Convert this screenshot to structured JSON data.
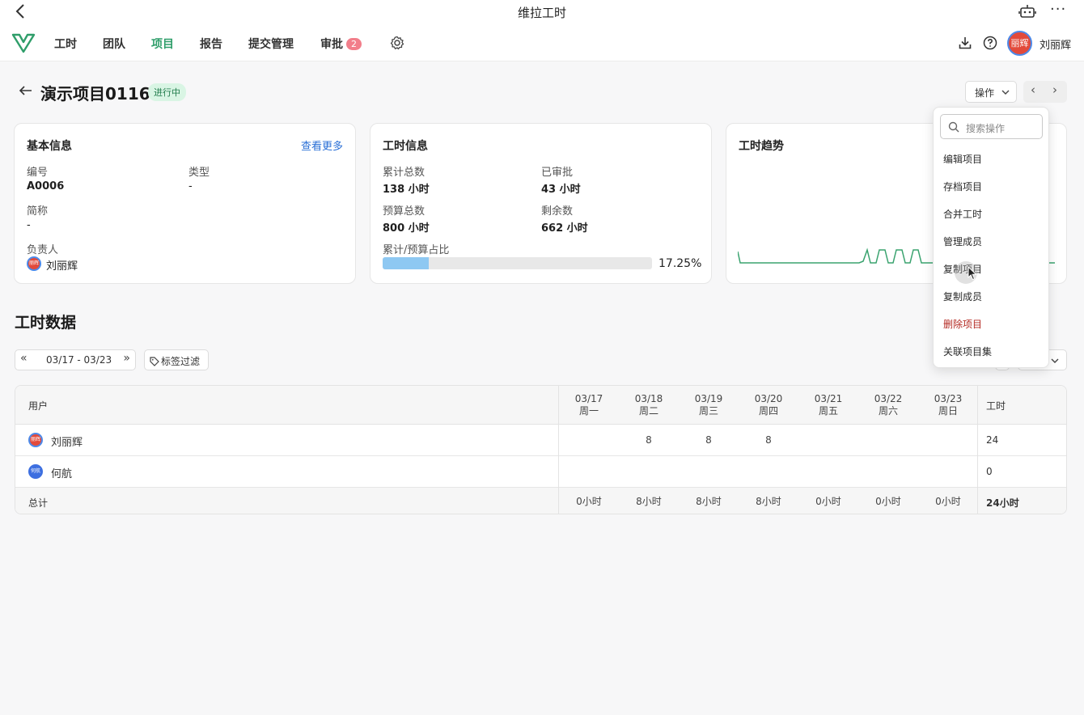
{
  "app": {
    "window_title": "维拉工时",
    "user_name": "刘丽辉",
    "avatar_text": "丽辉"
  },
  "nav": {
    "items": [
      "工时",
      "团队",
      "项目",
      "报告",
      "提交管理",
      "审批"
    ],
    "approval_badge": "2"
  },
  "project": {
    "title": "演示项目0116",
    "status": "进行中",
    "ops_button": "操作"
  },
  "basic_info": {
    "title": "基本信息",
    "more_link": "查看更多",
    "code_label": "编号",
    "code_value": "A0006",
    "type_label": "类型",
    "type_value": "-",
    "short_label": "简称",
    "short_value": "-",
    "owner_label": "负责人",
    "owner_value": "刘丽辉"
  },
  "hours_info": {
    "title": "工时信息",
    "total_label": "累计总数",
    "total_value": "138 小时",
    "approved_label": "已审批",
    "approved_value": "43 小时",
    "budget_label": "预算总数",
    "budget_value": "800 小时",
    "remaining_label": "剩余数",
    "remaining_value": "662 小时",
    "ratio_label": "累计/预算占比",
    "ratio_value": "17.25%",
    "ratio_fraction": 0.1725
  },
  "trend": {
    "title": "工时趋势"
  },
  "section": {
    "title": "工时数据"
  },
  "filters": {
    "date_range": "03/17 - 03/23",
    "tag_filter": "标签过滤"
  },
  "table": {
    "user_header": "用户",
    "hours_header": "工时",
    "days": [
      {
        "date": "03/17",
        "weekday": "周一"
      },
      {
        "date": "03/18",
        "weekday": "周二"
      },
      {
        "date": "03/19",
        "weekday": "周三"
      },
      {
        "date": "03/20",
        "weekday": "周四"
      },
      {
        "date": "03/21",
        "weekday": "周五"
      },
      {
        "date": "03/22",
        "weekday": "周六"
      },
      {
        "date": "03/23",
        "weekday": "周日"
      }
    ],
    "rows": [
      {
        "name": "刘丽辉",
        "avatar": "丽辉",
        "values": [
          "",
          "8",
          "8",
          "8",
          "",
          "",
          ""
        ],
        "total": "24"
      },
      {
        "name": "何航",
        "avatar": "何航",
        "values": [
          "",
          "",
          "",
          "",
          "",
          "",
          ""
        ],
        "total": "0"
      }
    ],
    "total_label": "总计",
    "totals": [
      "0小时",
      "8小时",
      "8小时",
      "8小时",
      "0小时",
      "0小时",
      "0小时"
    ],
    "grand_total": "24小时"
  },
  "dropdown": {
    "search_placeholder": "搜索操作",
    "items": [
      "编辑项目",
      "存档项目",
      "合并工时",
      "管理成员",
      "复制项目",
      "复制成员",
      "删除项目",
      "关联项目集"
    ]
  },
  "colors": {
    "accent": "#2f9e6a",
    "danger": "#b42a23",
    "link": "#2a6fd6",
    "badge": "#f27e8a"
  }
}
